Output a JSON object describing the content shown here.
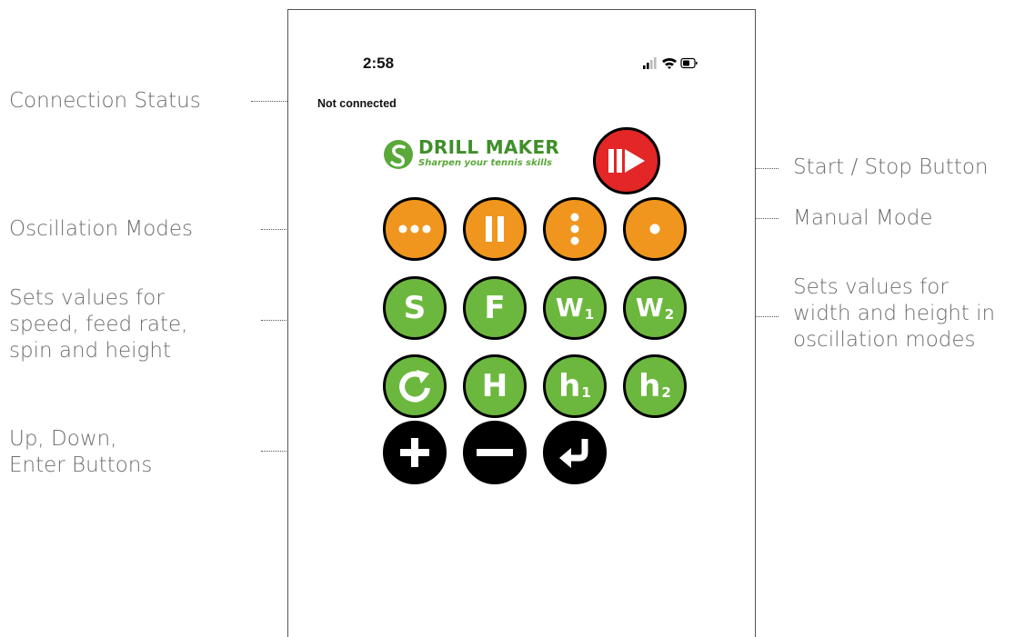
{
  "annotations": {
    "connection_status": "Connection Status",
    "oscillation_modes": "Oscillation Modes",
    "sets_values_left": [
      "Sets values for",
      "speed, feed rate,",
      "spin and height"
    ],
    "up_down_enter": [
      "Up, Down,",
      "Enter Buttons"
    ],
    "start_stop": "Start / Stop Button",
    "manual_mode": "Manual Mode",
    "sets_values_right": [
      "Sets values for",
      "width and height in",
      "oscillation modes"
    ]
  },
  "phone": {
    "status_bar": {
      "time": "2:58",
      "icons": [
        "signal-icon",
        "wifi-icon",
        "battery-icon"
      ]
    },
    "connection_status": "Not connected",
    "logo": {
      "title": "DRILL MAKER",
      "subtitle": "Sharpen your tennis skills"
    },
    "buttons": {
      "start_stop": {
        "icon": "play-pause-icon"
      },
      "oscillation": [
        {
          "icon": "three-dots-horizontal-icon"
        },
        {
          "icon": "two-bars-icon"
        },
        {
          "icon": "three-dots-vertical-icon"
        }
      ],
      "manual_mode": {
        "icon": "single-dot-icon"
      },
      "settings_row1": [
        {
          "label": "S"
        },
        {
          "label": "F"
        },
        {
          "label": "W",
          "sub": "1"
        },
        {
          "label": "W",
          "sub": "2"
        }
      ],
      "settings_row2": [
        {
          "icon": "spin-arrow-icon"
        },
        {
          "label": "H"
        },
        {
          "label": "h",
          "sub": "1"
        },
        {
          "label": "h",
          "sub": "2"
        }
      ],
      "controls": [
        {
          "icon": "plus-icon"
        },
        {
          "icon": "minus-icon"
        },
        {
          "icon": "enter-icon"
        }
      ]
    },
    "colors": {
      "orange": "#f0961e",
      "green": "#6cb83e",
      "red": "#e32626",
      "black": "#000000",
      "logo_green": "#3f8f2a"
    }
  }
}
